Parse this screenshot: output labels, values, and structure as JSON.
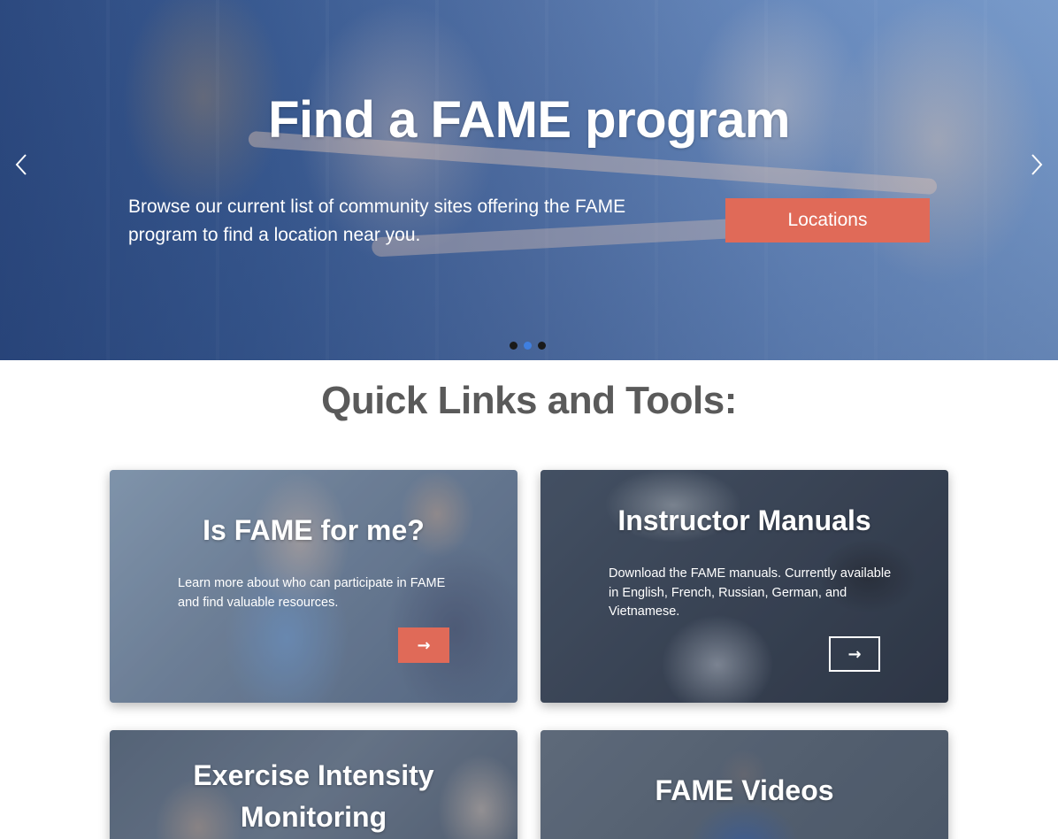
{
  "hero": {
    "title": "Find a FAME program",
    "description_line1": "Browse our current list of community sites offering the FAME",
    "description_line2": "program to find a location near you.",
    "button_label": "Locations",
    "prev_icon": "chevron-left-icon",
    "next_icon": "chevron-right-icon",
    "slides": 3,
    "active_slide": 2
  },
  "quick_links": {
    "title": "Quick Links and Tools:",
    "cards": [
      {
        "title": "Is FAME for me?",
        "text_line1": "Learn more about who can participate in FAME",
        "text_line2": "and find valuable resources.",
        "button_icon": "arrow-right-icon",
        "button_glyph": "→",
        "button_style": "filled"
      },
      {
        "title": "Instructor Manuals",
        "text_line1": "Download the FAME manuals. Currently available",
        "text_line2": "in English, French, Russian, German, and",
        "text_line3": "Vietnamese.",
        "button_icon": "arrow-right-icon",
        "button_glyph": "→",
        "button_style": "outline"
      },
      {
        "title_line1": "Exercise Intensity",
        "title_line2": "Monitoring"
      },
      {
        "title": "FAME Videos"
      }
    ]
  },
  "colors": {
    "accent": "#e06a58",
    "heading_gray": "#5a5a5a",
    "active_dot": "#3f7fe0"
  }
}
